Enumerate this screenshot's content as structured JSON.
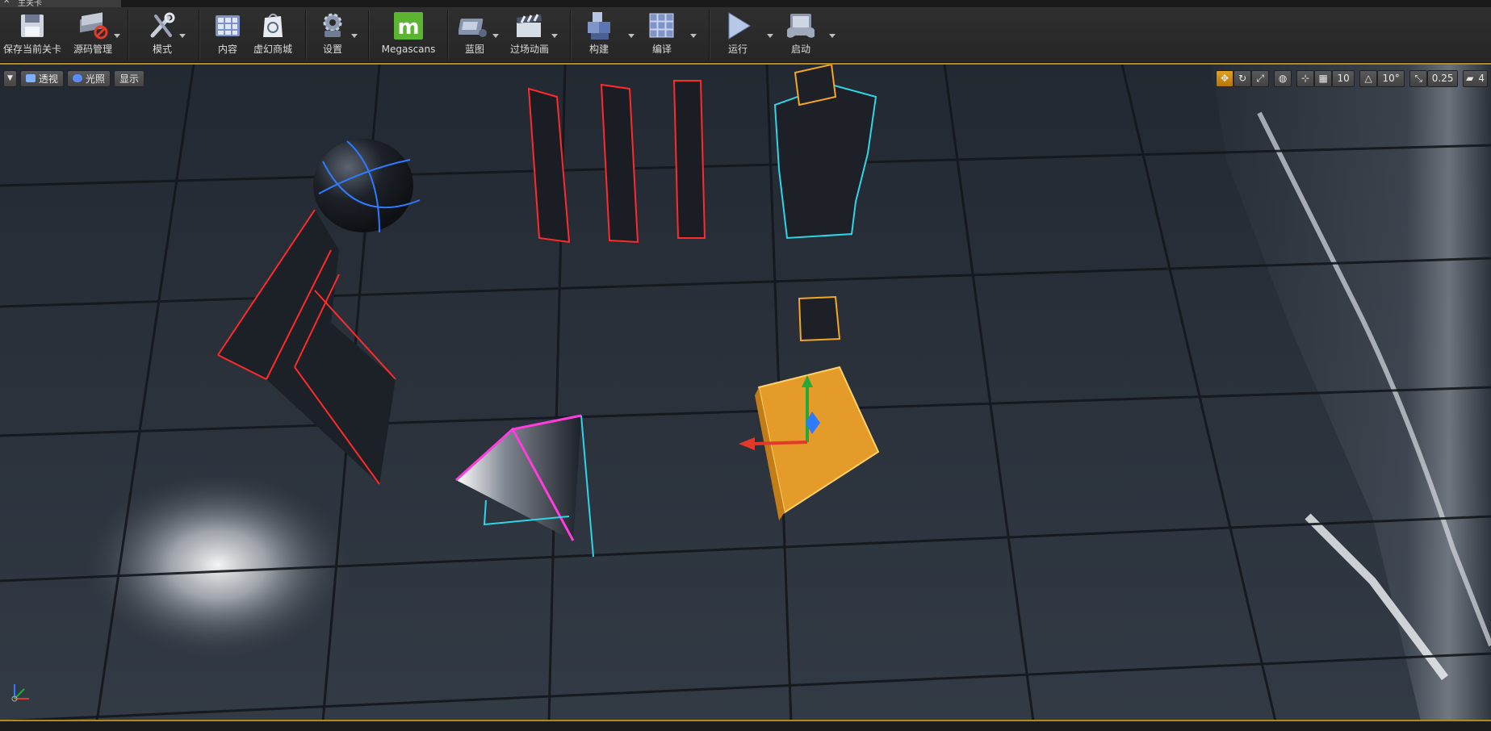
{
  "title_tab": "主关卡",
  "toolbar": {
    "save": "保存当前关卡",
    "source_control": "源码管理",
    "modes": "模式",
    "content": "内容",
    "marketplace": "虚幻商城",
    "settings": "设置",
    "megascans": "Megascans",
    "blueprints": "蓝图",
    "cinematics": "过场动画",
    "build": "构建",
    "compile": "编译",
    "play": "运行",
    "launch": "启动"
  },
  "viewport": {
    "perspective": "透视",
    "lit": "光照",
    "show": "显示",
    "grid_snap": "10",
    "rotation_snap": "10°",
    "scale_snap": "0.25",
    "camera_speed": "4"
  },
  "colors": {
    "accent": "#b08a1c",
    "selection": "#e3a020",
    "viewport_bg": "#2b313a"
  }
}
